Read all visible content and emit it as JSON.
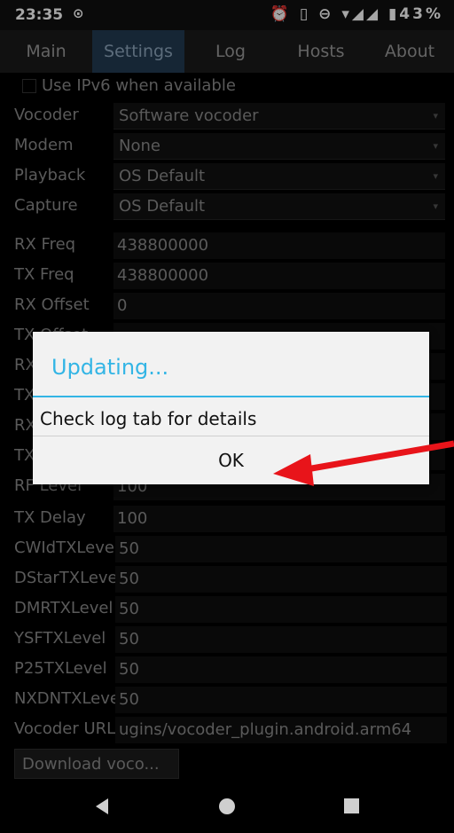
{
  "status": {
    "time": "23:35",
    "icons_text": "⏰ ▯ ⊖ ▾◢◢ ▮43%"
  },
  "tabs": [
    {
      "label": "Main"
    },
    {
      "label": "Settings"
    },
    {
      "label": "Log"
    },
    {
      "label": "Hosts"
    },
    {
      "label": "About"
    }
  ],
  "settings": {
    "ipv6_label": "Use IPv6 when available",
    "vocoder_label": "Vocoder",
    "vocoder_value": "Software vocoder",
    "modem_label": "Modem",
    "modem_value": "None",
    "playback_label": "Playback",
    "playback_value": "OS Default",
    "capture_label": "Capture",
    "capture_value": "OS Default",
    "rx_freq_label": "RX Freq",
    "rx_freq_value": "438800000",
    "tx_freq_label": "TX Freq",
    "tx_freq_value": "438800000",
    "rx_offset_label": "RX Offset",
    "rx_offset_value": "0",
    "tx_offset_label": "TX Offset",
    "rf_level_label": "RF Level",
    "rf_level_value": "100",
    "tx_delay_label": "TX Delay",
    "tx_delay_value": "100",
    "cwid_label": "CWIdTXLevel",
    "cwid_value": "50",
    "dstar_label": "DStarTXLevel",
    "dstar_value": "50",
    "dmr_label": "DMRTXLevel",
    "dmr_value": "50",
    "ysf_label": "YSFTXLevel",
    "ysf_value": "50",
    "p25_label": "P25TXLevel",
    "p25_value": "50",
    "nxdn_label": "NXDNTXLevel",
    "nxdn_value": "50",
    "vocoder_url_label": "Vocoder URL",
    "vocoder_url_value": "ugins/vocoder_plugin.android.arm64",
    "download_button": "Download voco..."
  },
  "dialog": {
    "title": "Updating...",
    "message": "Check log tab for details",
    "ok": "OK"
  },
  "colors": {
    "accent": "#33b5e5",
    "annotation_arrow": "#e8141a"
  }
}
